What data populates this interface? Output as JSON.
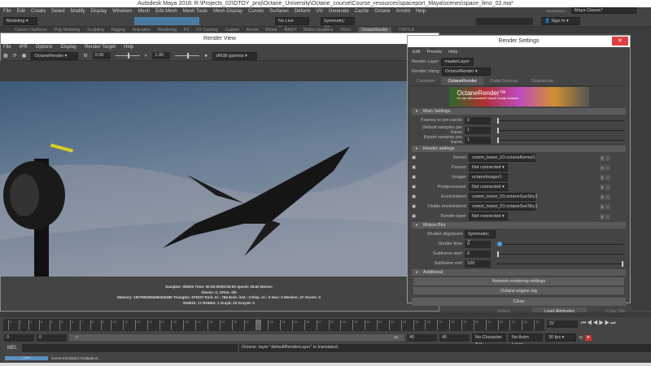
{
  "app": {
    "title": "Autodesk Maya 2018: R:\\Projects_02\\OTOY_proj\\Octane_University\\Octane_course\\Course_resources\\spaceport_Maya\\scenes\\space_limo_02.ma*"
  },
  "menu": [
    "File",
    "Edit",
    "Create",
    "Select",
    "Modify",
    "Display",
    "Windows",
    "Mesh",
    "Edit Mesh",
    "Mesh Tools",
    "Mesh Display",
    "Curves",
    "Surfaces",
    "Deform",
    "UV",
    "Generate",
    "Cache",
    "Octane",
    "Arnold",
    "Help"
  ],
  "toolbar": {
    "mode": "Modeling",
    "live_surface": "No Live Surface",
    "symmetry": "Symmetry: Off",
    "sign_in": "Sign In",
    "workspace_label": "Workspace :",
    "workspace": "Maya Classic*"
  },
  "shelf_tabs": [
    "Curves / Surfaces",
    "Poly Modeling",
    "Sculpting",
    "Rigging",
    "Animation",
    "Rendering",
    "FX",
    "FX Caching",
    "Custom",
    "Arnold",
    "Bifrost",
    "MASH",
    "Motion Graphics",
    "XGen",
    "OctaneRender",
    "TURTLE"
  ],
  "shelf_active": "OctaneRender",
  "render_view": {
    "title": "Render View",
    "menu": [
      "File",
      "IPR",
      "Options",
      "Display",
      "Render Target",
      "Help"
    ],
    "renderer": "OctaneRender",
    "exposure": "0.00",
    "gamma": "1.00",
    "colorspace": "sRGB gamma",
    "stats": [
      "Samples: 0/5000 Time: 00:00:00/00:00:00 Speed: 29.62 Ms/sec",
      "Slaves: 0, GPUs: 0/0",
      "Memory: 190790/206408/425490 Triangles: 576237 Emit. tri.: 766 Emit. inst.: 3 Disp. tri.: 0 Hair: 0 Meshes: 47 Voxels: 0",
      "RGB32: 17 RGB64: 1 Gray8: 20 Gray16: 0"
    ]
  },
  "render_settings": {
    "title": "Render Settings",
    "menu": [
      "Edit",
      "Presets",
      "Help"
    ],
    "render_layer_label": "Render Layer",
    "render_layer": "masterLayer",
    "render_using_label": "Render Using",
    "render_using": "OctaneRender",
    "tabs": [
      "Common",
      "OctaneRender",
      "Cuda Devices",
      "OctaneLive"
    ],
    "active_tab": "OctaneRender",
    "banner": "OctaneRender™",
    "banner_sub": "For use with Autodesk® Maya® Design Software",
    "main_settings": {
      "title": "Main Settings",
      "fields": [
        {
          "label": "Frames to pre-cache",
          "value": "0"
        },
        {
          "label": "Default samples per frame",
          "value": "1"
        },
        {
          "label": "Export samples per frame",
          "value": "1"
        }
      ]
    },
    "render_settings_sec": {
      "title": "Render settings",
      "rows": [
        {
          "label": "Kernel",
          "value": "comm_tower_01:octaneKernel1"
        },
        {
          "label": "Passes",
          "value": "Not connected"
        },
        {
          "label": "Imager",
          "value": "octaneImager1"
        },
        {
          "label": "Postprocessor",
          "value": "Not connected"
        },
        {
          "label": "Environment",
          "value": "comm_tower_01:octaneSunSky1"
        },
        {
          "label": "Visible environment",
          "value": "comm_tower_01:octaneSunSky1"
        },
        {
          "label": "Render layer",
          "value": "Not connected"
        }
      ]
    },
    "motion_blur": {
      "title": "Motion Blur",
      "shutter_alignment_label": "Shutter alignment",
      "shutter_alignment": "Symmetric",
      "shutter_time_label": "Shutter time",
      "shutter_time": "0",
      "subframe_start_label": "Subframe start",
      "subframe_start": "0",
      "subframe_end_label": "Subframe end",
      "subframe_end": "100"
    },
    "additional": {
      "title": "Additional",
      "buttons": [
        "Network rendering settings",
        "Octane engine log"
      ]
    },
    "close": "Close"
  },
  "attr_buttons": [
    "Select",
    "Load Attributes",
    "Copy Tab"
  ],
  "timeline": {
    "ticks": [
      "0",
      "1",
      "2",
      "3",
      "4",
      "5",
      "6",
      "7",
      "8",
      "9",
      "10",
      "11",
      "12",
      "13",
      "14",
      "15",
      "16",
      "17",
      "18",
      "19",
      "20",
      "21",
      "22",
      "23",
      "24",
      "25",
      "26",
      "27",
      "28",
      "29",
      "30",
      "31",
      "32",
      "33",
      "34",
      "35",
      "36",
      "37",
      "38",
      "39",
      "40",
      "41",
      "42",
      "43",
      "44",
      "45"
    ],
    "current_frame": "22"
  },
  "range": {
    "start": "0",
    "playback_start": "0",
    "slider_start": "0",
    "slider_end": "45",
    "playback_end": "45",
    "end": "45",
    "character_set": "No Character Set",
    "anim_layer": "No Anim Layer",
    "fps": "30 fps"
  },
  "command": {
    "lang": "MEL",
    "result": "Octane: layer \"defaultRenderLayer\" is translated."
  },
  "help_line": {
    "progress_percent": 100,
    "progress_label": "100%",
    "text": "Scene translated. Evaluation..."
  }
}
